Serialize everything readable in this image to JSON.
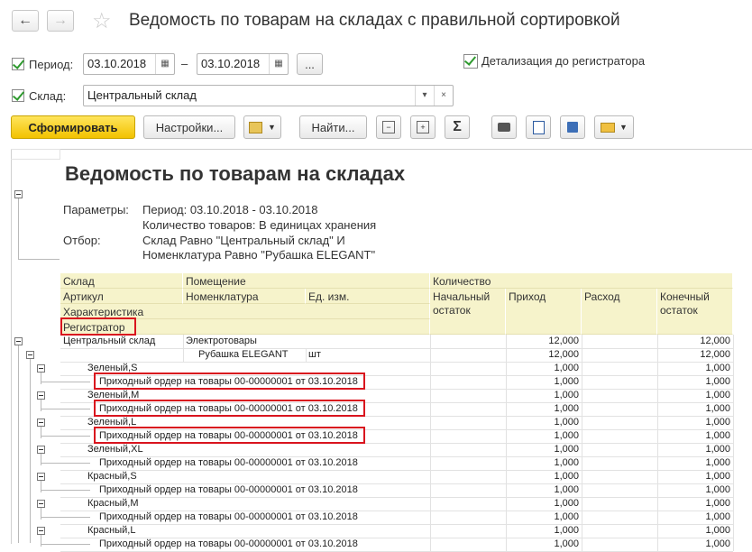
{
  "window": {
    "title": "Ведомость по товарам на складах с правильной сортировкой"
  },
  "nav": {
    "back_icon": "←",
    "forward_icon": "→",
    "star_icon": "☆"
  },
  "filters": {
    "period_label": "Период:",
    "date_from": "03.10.2018",
    "date_to": "03.10.2018",
    "dash": "–",
    "more": "...",
    "detail_label": "Детализация до регистратора",
    "warehouse_label": "Склад:",
    "warehouse_value": "Центральный склад"
  },
  "toolbar": {
    "generate": "Сформировать",
    "settings": "Настройки...",
    "find": "Найти...",
    "sum_icon": "Σ"
  },
  "report": {
    "title": "Ведомость по товарам на складах",
    "params_label": "Параметры:",
    "params_lines": [
      "Период: 03.10.2018 - 03.10.2018",
      "Количество товаров: В единицах хранения"
    ],
    "filter_label": "Отбор:",
    "filter_lines": [
      "Склад Равно \"Центральный склад\" И",
      "Номенклатура Равно \"Рубашка ELEGANT\""
    ],
    "headers": {
      "warehouse": "Склад",
      "room": "Помещение",
      "quantity": "Количество",
      "article": "Артикул",
      "nomenclature": "Номенклатура",
      "unit": "Ед. изм.",
      "start": "Начальный остаток",
      "income": "Приход",
      "expense": "Расход",
      "end": "Конечный остаток",
      "characteristic": "Характеристика",
      "registrar": "Регистратор"
    },
    "rows": [
      {
        "label": "Центральный склад",
        "room": "Электротовары",
        "income": "12,000",
        "end": "12,000"
      },
      {
        "label": "",
        "room": "Рубашка ELEGANT",
        "unit": "шт",
        "income": "12,000",
        "end": "12,000"
      },
      {
        "label": "Зеленый,S",
        "income": "1,000",
        "end": "1,000"
      },
      {
        "label": "Приходный ордер на товары 00-00000001 от 03.10.2018",
        "income": "1,000",
        "end": "1,000"
      },
      {
        "label": "Зеленый,M",
        "income": "1,000",
        "end": "1,000"
      },
      {
        "label": "Приходный ордер на товары 00-00000001 от 03.10.2018",
        "income": "1,000",
        "end": "1,000"
      },
      {
        "label": "Зеленый,L",
        "income": "1,000",
        "end": "1,000"
      },
      {
        "label": "Приходный ордер на товары 00-00000001 от 03.10.2018",
        "income": "1,000",
        "end": "1,000"
      },
      {
        "label": "Зеленый,XL",
        "income": "1,000",
        "end": "1,000"
      },
      {
        "label": "Приходный ордер на товары 00-00000001 от 03.10.2018",
        "income": "1,000",
        "end": "1,000"
      },
      {
        "label": "Красный,S",
        "income": "1,000",
        "end": "1,000"
      },
      {
        "label": "Приходный ордер на товары 00-00000001 от 03.10.2018",
        "income": "1,000",
        "end": "1,000"
      },
      {
        "label": "Красный,M",
        "income": "1,000",
        "end": "1,000"
      },
      {
        "label": "Приходный ордер на товары 00-00000001 от 03.10.2018",
        "income": "1,000",
        "end": "1,000"
      },
      {
        "label": "Красный,L",
        "income": "1,000",
        "end": "1,000"
      },
      {
        "label": "Приходный ордер на товары 00-00000001 от 03.10.2018",
        "income": "1,000",
        "end": "1,000"
      }
    ]
  }
}
